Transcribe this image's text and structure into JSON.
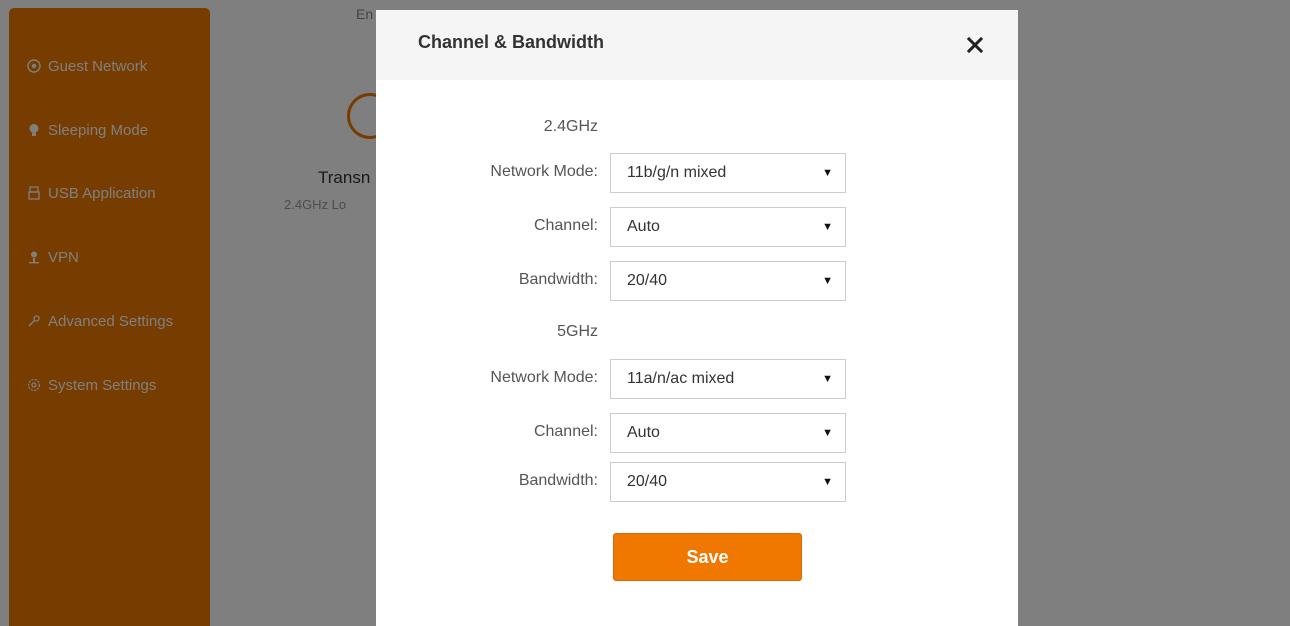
{
  "sidebar": {
    "items": [
      {
        "label": "Guest Network",
        "icon": "wifi-guest-icon"
      },
      {
        "label": "Sleeping Mode",
        "icon": "bulb-icon"
      },
      {
        "label": "USB Application",
        "icon": "usb-icon"
      },
      {
        "label": "VPN",
        "icon": "person-icon"
      },
      {
        "label": "Advanced Settings",
        "icon": "wrench-icon"
      },
      {
        "label": "System Settings",
        "icon": "gear-icon"
      }
    ]
  },
  "background": {
    "top_text": "En",
    "card_title": "Transn",
    "card_subtitle": "2.4GHz Lo"
  },
  "modal": {
    "title": "Channel & Bandwidth",
    "close_icon": "close-icon",
    "band_24": {
      "label": "2.4GHz",
      "network_mode_label": "Network Mode:",
      "network_mode_value": "11b/g/n mixed",
      "channel_label": "Channel:",
      "channel_value": "Auto",
      "bandwidth_label": "Bandwidth:",
      "bandwidth_value": "20/40"
    },
    "band_5": {
      "label": "5GHz",
      "network_mode_label": "Network Mode:",
      "network_mode_value": "11a/n/ac mixed",
      "channel_label": "Channel:",
      "channel_value": "Auto",
      "bandwidth_label": "Bandwidth:",
      "bandwidth_value": "20/40"
    },
    "save_label": "Save"
  },
  "colors": {
    "accent": "#f07800",
    "overlay": "rgba(0,0,0,0.5)"
  }
}
